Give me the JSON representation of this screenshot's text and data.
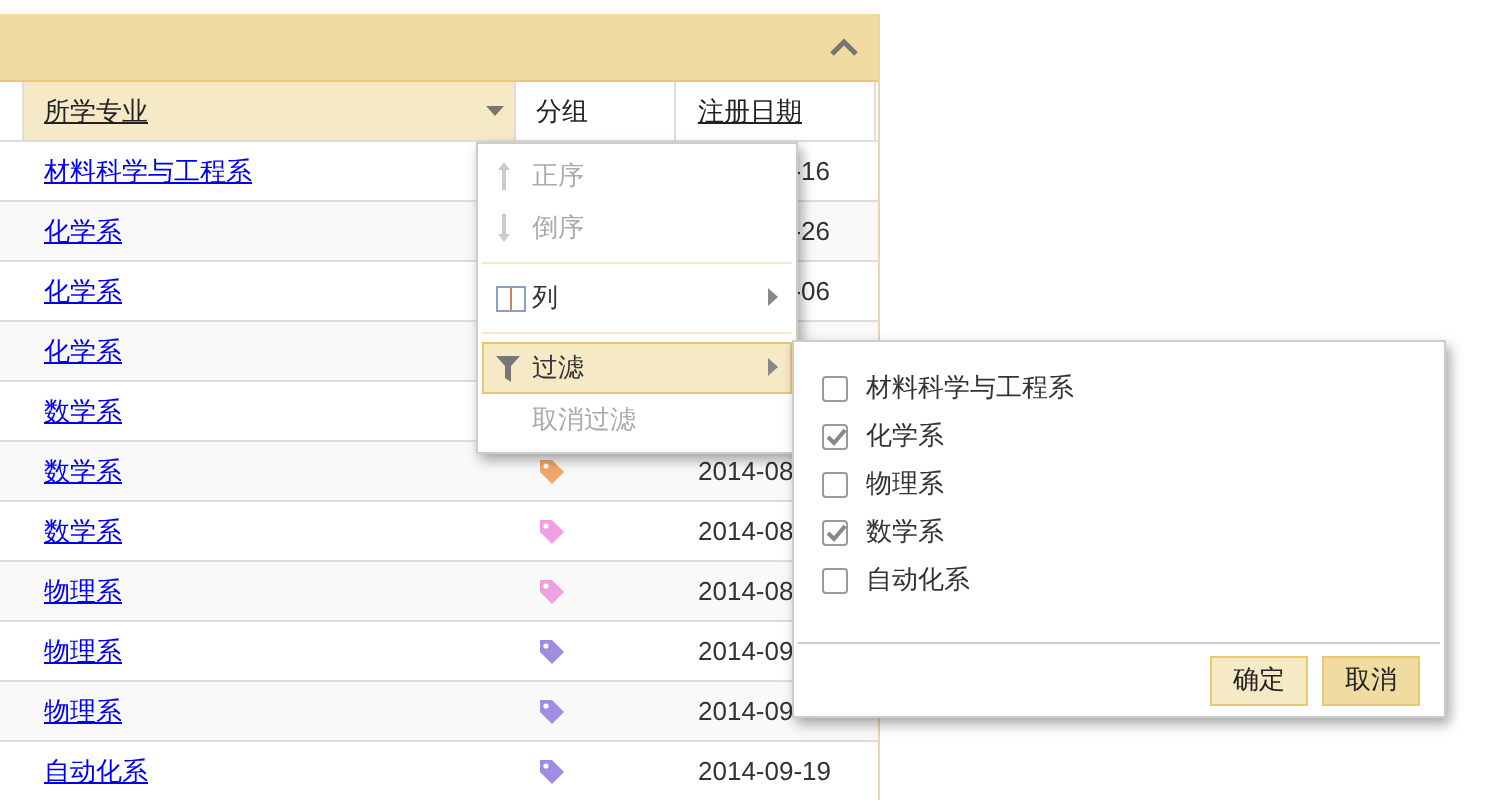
{
  "header": {
    "expanded": true
  },
  "columns": [
    {
      "label": "所学专业",
      "active": true,
      "underlined": true
    },
    {
      "label": "分组",
      "active": false,
      "underlined": false
    },
    {
      "label": "注册日期",
      "active": false,
      "underlined": true
    }
  ],
  "rows": [
    {
      "major": "材料科学与工程系",
      "date": "-16",
      "date_clipped_left": true
    },
    {
      "major": "化学系",
      "date": "-26",
      "date_clipped_left": true
    },
    {
      "major": "化学系",
      "date": "-06",
      "date_clipped_left": true
    },
    {
      "major": "化学系"
    },
    {
      "major": "数学系"
    },
    {
      "major": "数学系",
      "color": "#f0a868",
      "date": "2014-08"
    },
    {
      "major": "数学系",
      "color": "#f0a0e0",
      "date": "2014-08"
    },
    {
      "major": "物理系",
      "color": "#f0a0e0",
      "date": "2014-08"
    },
    {
      "major": "物理系",
      "color": "#a08ce0",
      "date": "2014-09"
    },
    {
      "major": "物理系",
      "color": "#a08ce0",
      "date": "2014-09"
    },
    {
      "major": "自动化系",
      "color": "#a08ce0",
      "date": "2014-09-19"
    }
  ],
  "column_menu": [
    {
      "kind": "sort-asc",
      "label": "正序",
      "disabled": true,
      "selected": false,
      "submenu": false,
      "divider_before": false
    },
    {
      "kind": "sort-desc",
      "label": "倒序",
      "disabled": true,
      "selected": false,
      "submenu": false,
      "divider_before": false
    },
    {
      "kind": "columns",
      "label": "列",
      "disabled": false,
      "selected": false,
      "submenu": true,
      "divider_before": true
    },
    {
      "kind": "filter",
      "label": "过滤",
      "disabled": false,
      "selected": true,
      "submenu": true,
      "divider_before": true
    },
    {
      "kind": "clear",
      "label": "取消过滤",
      "disabled": true,
      "selected": false,
      "submenu": false,
      "divider_before": false
    }
  ],
  "filter_menu": {
    "options": [
      {
        "label": "材料科学与工程系",
        "checked": false
      },
      {
        "label": "化学系",
        "checked": true
      },
      {
        "label": "物理系",
        "checked": false
      },
      {
        "label": "数学系",
        "checked": true
      },
      {
        "label": "自动化系",
        "checked": false
      }
    ],
    "buttons": [
      {
        "label": "确定",
        "kind": "confirm"
      },
      {
        "label": "取消",
        "kind": "cancel"
      }
    ]
  }
}
